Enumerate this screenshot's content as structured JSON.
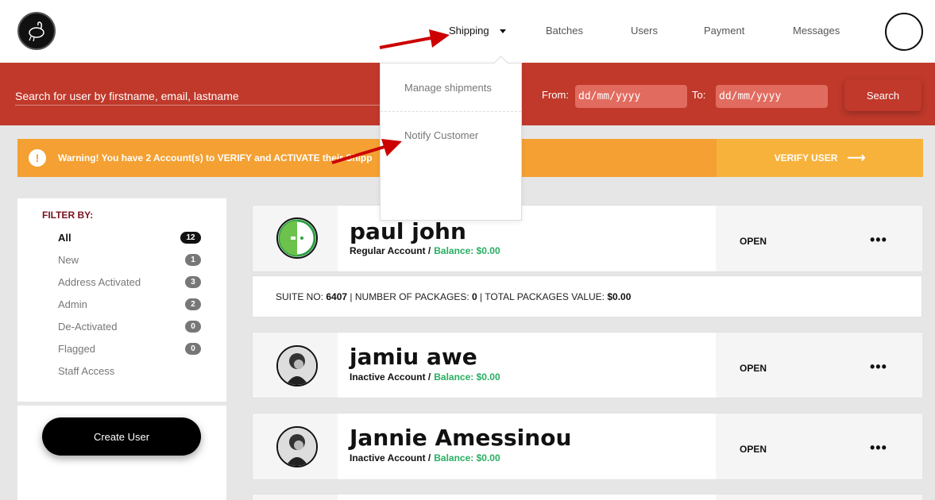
{
  "nav": {
    "items": [
      "Shipping",
      "Batches",
      "Users",
      "Payment",
      "Messages"
    ]
  },
  "dropdown": {
    "items": [
      "Manage shipments",
      "Notify Customer"
    ]
  },
  "search": {
    "placeholder": "Search for user by firstname, email, lastname",
    "from_label": "From:",
    "to_label": "To:",
    "date_placeholder": "dd/mm/yyyy",
    "button": "Search"
  },
  "warning": {
    "icon": "!",
    "text": "Warning! You have 2 Account(s) to VERIFY and ACTIVATE their Shipp",
    "action": "VERIFY USER",
    "action_icon": "⟶"
  },
  "filter": {
    "title": "FILTER BY:",
    "items": [
      {
        "label": "All",
        "count": "12"
      },
      {
        "label": "New",
        "count": "1"
      },
      {
        "label": "Address Activated",
        "count": "3"
      },
      {
        "label": "Admin",
        "count": "2"
      },
      {
        "label": "De-Activated",
        "count": "0"
      },
      {
        "label": "Flagged",
        "count": "0"
      },
      {
        "label": "Staff Access",
        "count": ""
      }
    ]
  },
  "create_user": "Create User",
  "users": [
    {
      "name": "paul john",
      "account": "Regular Account /",
      "balance": "Balance: $0.00",
      "status": "OPEN",
      "more": "•••"
    },
    {
      "name": "jamiu awe",
      "account": "Inactive Account /",
      "balance": "Balance: $0.00",
      "status": "OPEN",
      "more": "•••"
    },
    {
      "name": "Jannie Amessinou",
      "account": "Inactive Account /",
      "balance": "Balance: $0.00",
      "status": "OPEN",
      "more": "•••"
    }
  ],
  "suite": {
    "suite_label": "SUITE NO:",
    "suite_no": "6407",
    "packages_label": "| NUMBER OF PACKAGES:",
    "packages": "0",
    "value_label": "| TOTAL PACKAGES VALUE:",
    "value": "$0.00"
  },
  "colors": {
    "brand_red": "#c0392b",
    "warning": "#f4a032",
    "balance_green": "#27ae60",
    "arrow_red": "#cc0000"
  }
}
